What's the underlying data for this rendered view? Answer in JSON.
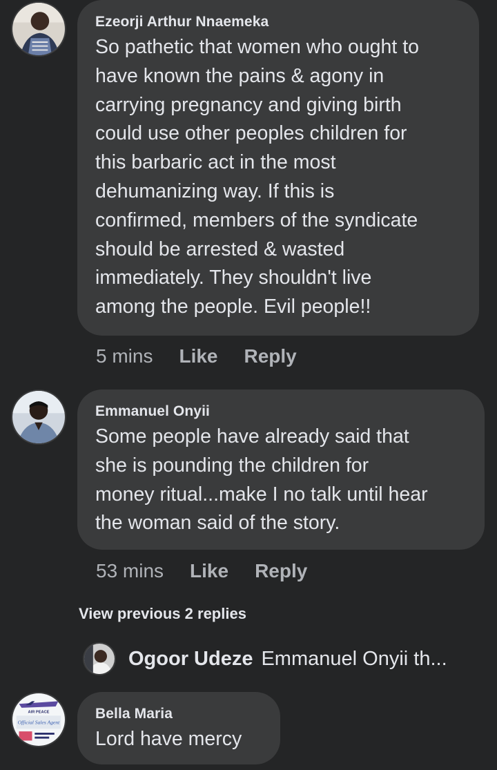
{
  "comments": [
    {
      "author": "Ezeorji Arthur Nnaemeka",
      "text": "So pathetic that women who ought to\nhave known the pains & agony in\ncarrying pregnancy and giving birth\ncould use other peoples children for\nthis barbaric act in the most\ndehumanizing way. If this is\nconfirmed, members of the syndicate\nshould be arrested & wasted\nimmediately. They shouldn't live\namong the people. Evil people!!",
      "time": "5 mins",
      "like": "Like",
      "reply": "Reply"
    },
    {
      "author": "Emmanuel Onyii",
      "text": "Some people have already said that\nshe is pounding the children for\nmoney ritual...make I no talk until hear\nthe woman said of the story.",
      "time": "53 mins",
      "like": "Like",
      "reply": "Reply",
      "view_previous": "View previous 2 replies",
      "reply_preview": {
        "author": "Ogoor Udeze",
        "text": "Emmanuel Onyii th..."
      }
    },
    {
      "author": "Bella Maria",
      "text": "Lord have mercy",
      "avatar_text": {
        "line1": "AIR PEACE",
        "line2": "Official Sales Agent"
      }
    }
  ],
  "colors": {
    "background": "#242526",
    "bubble": "#3a3b3c",
    "primary_text": "#e4e6eb",
    "secondary_text": "#b0b3b8"
  }
}
